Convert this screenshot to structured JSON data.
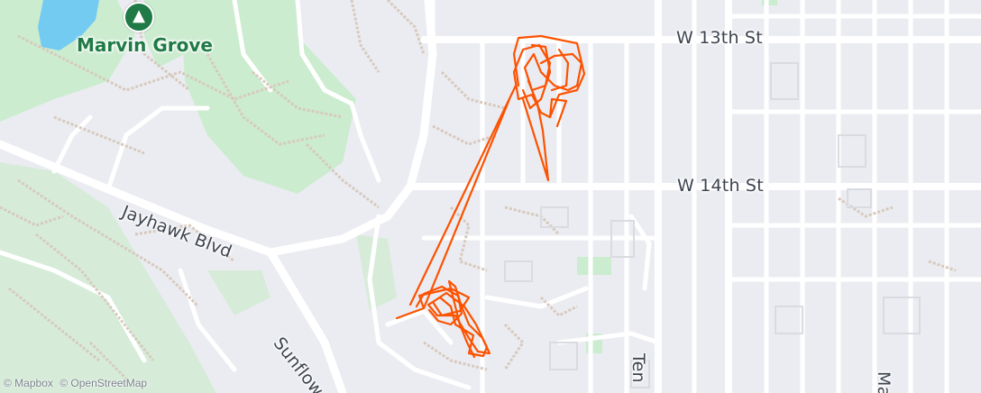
{
  "map": {
    "park": {
      "name": "Marvin Grove",
      "icon": "tree-icon"
    },
    "streets": {
      "w13": "W 13th St",
      "w14": "W 14th St",
      "jayhawk": "Jayhawk Blvd",
      "sunflower": "Sunflow",
      "ten": "Ten",
      "ma": "Ma"
    },
    "attribution": {
      "mapbox": "© Mapbox",
      "osm": "© OpenStreetMap"
    },
    "colors": {
      "route": "#fc5200",
      "park": "#cbeccf",
      "water": "#73cbf2",
      "road": "#ffffff",
      "background": "#ebecf1"
    }
  }
}
